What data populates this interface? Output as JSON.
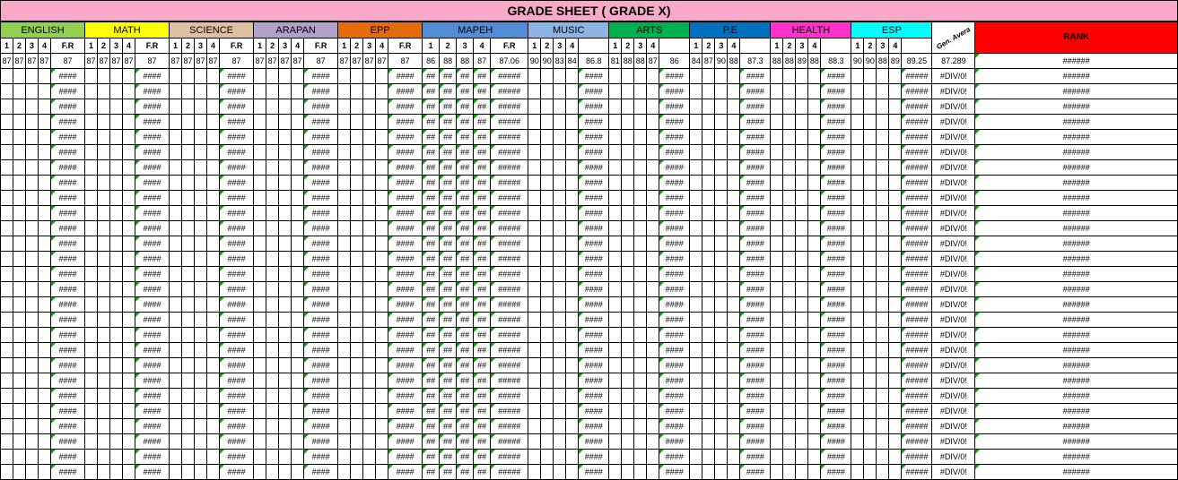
{
  "title": "GRADE SHEET ( GRADE X)",
  "subjects": [
    {
      "name": "ENGLISH",
      "bg": "#92d050",
      "cols": [
        "1",
        "2",
        "3",
        "4"
      ],
      "fr": "F.R",
      "row": [
        "87",
        "87",
        "87",
        "87",
        "87"
      ]
    },
    {
      "name": "MATH",
      "bg": "#ffff00",
      "cols": [
        "1",
        "2",
        "3",
        "4"
      ],
      "fr": "F.R",
      "row": [
        "87",
        "87",
        "87",
        "87",
        "87"
      ]
    },
    {
      "name": "SCIENCE",
      "bg": "#dfc1a1",
      "cols": [
        "1",
        "2",
        "3",
        "4"
      ],
      "fr": "F.R",
      "row": [
        "87",
        "87",
        "87",
        "87",
        "87"
      ]
    },
    {
      "name": "ARAPAN",
      "bg": "#b1a0c7",
      "cols": [
        "1",
        "2",
        "3",
        "4"
      ],
      "fr": "F.R",
      "row": [
        "87",
        "87",
        "87",
        "87",
        "87"
      ]
    },
    {
      "name": "EPP",
      "bg": "#e46c0a",
      "cols": [
        "1",
        "2",
        "3",
        "4"
      ],
      "fr": "F.R",
      "row": [
        "87",
        "87",
        "87",
        "87",
        "87"
      ]
    },
    {
      "name": "MAPEH",
      "bg": "#538dd5",
      "cols": [
        "1",
        "2",
        "3",
        "4"
      ],
      "fr": "F.R",
      "row": [
        "86",
        "88",
        "88",
        "87",
        "87.06"
      ]
    },
    {
      "name": "MUSIC",
      "bg": "#8db4e2",
      "cols": [
        "1",
        "2",
        "3",
        "4"
      ],
      "fr": "",
      "row": [
        "90",
        "90",
        "83",
        "84",
        "86.8"
      ]
    },
    {
      "name": "ARTS",
      "bg": "#00b050",
      "cols": [
        "1",
        "2",
        "3",
        "4"
      ],
      "fr": "",
      "row": [
        "81",
        "88",
        "88",
        "87",
        "86"
      ]
    },
    {
      "name": "P.E",
      "bg": "#0070c0",
      "cols": [
        "1",
        "2",
        "3",
        "4"
      ],
      "fr": "",
      "row": [
        "84",
        "87",
        "90",
        "88",
        "87.3"
      ]
    },
    {
      "name": "HEALTH",
      "bg": "#ff33cc",
      "cols": [
        "1",
        "2",
        "3",
        "4"
      ],
      "fr": "",
      "row": [
        "88",
        "88",
        "89",
        "88",
        "88.3"
      ]
    },
    {
      "name": "ESP",
      "bg": "#00ffff",
      "cols": [
        "1",
        "2",
        "3",
        "4"
      ],
      "fr": "",
      "row": [
        "90",
        "90",
        "88",
        "89",
        "89.25"
      ]
    }
  ],
  "gen_label": "Gen. Avera",
  "rank_label": "RANK",
  "gen_value": "87.289",
  "rank_value": "######",
  "hash_text": "####",
  "hash2_text": "##",
  "hash5_text": "#####",
  "div0": "#DIV/0!",
  "rank_hash": "######",
  "body_rows": 27
}
